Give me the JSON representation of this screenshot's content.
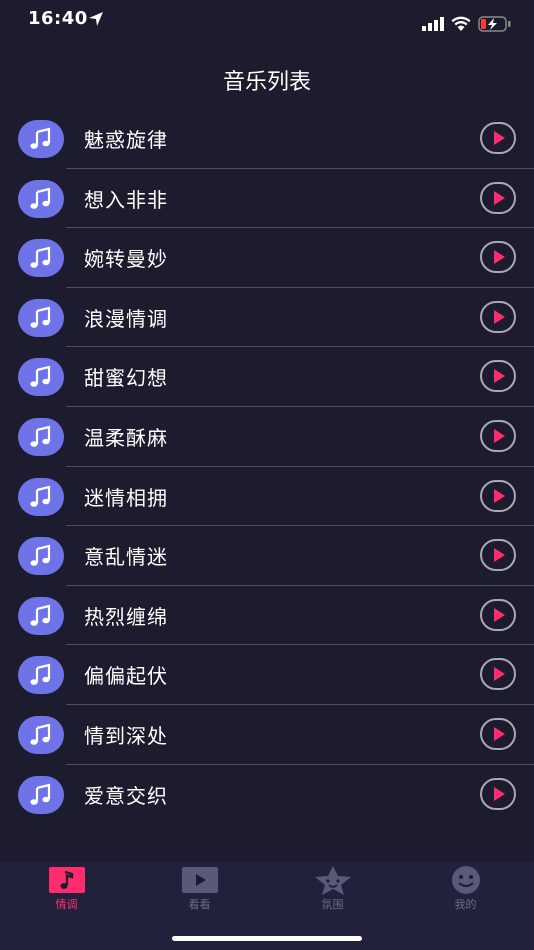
{
  "status_bar": {
    "time": "16:40"
  },
  "header": {
    "title": "音乐列表"
  },
  "music_list": [
    {
      "title": "魅惑旋律"
    },
    {
      "title": "想入非非"
    },
    {
      "title": "婉转曼妙"
    },
    {
      "title": "浪漫情调"
    },
    {
      "title": "甜蜜幻想"
    },
    {
      "title": "温柔酥麻"
    },
    {
      "title": "迷情相拥"
    },
    {
      "title": "意乱情迷"
    },
    {
      "title": "热烈缠绵"
    },
    {
      "title": "偏偏起伏"
    },
    {
      "title": "情到深处"
    },
    {
      "title": "爱意交织"
    }
  ],
  "tab_bar": {
    "items": [
      {
        "label": "情调",
        "icon": "music-note-icon",
        "active": true
      },
      {
        "label": "看看",
        "icon": "video-play-icon",
        "active": false
      },
      {
        "label": "氛围",
        "icon": "star-face-icon",
        "active": false
      },
      {
        "label": "我的",
        "icon": "smiley-face-icon",
        "active": false
      }
    ]
  },
  "colors": {
    "background": "#1d1c2f",
    "tab_bar_background": "#22213b",
    "music_icon_background": "#6f73e8",
    "play_triangle": "#ff2d6e",
    "active_tab": "#ff2d6e",
    "inactive_tab": "#5a5977"
  }
}
